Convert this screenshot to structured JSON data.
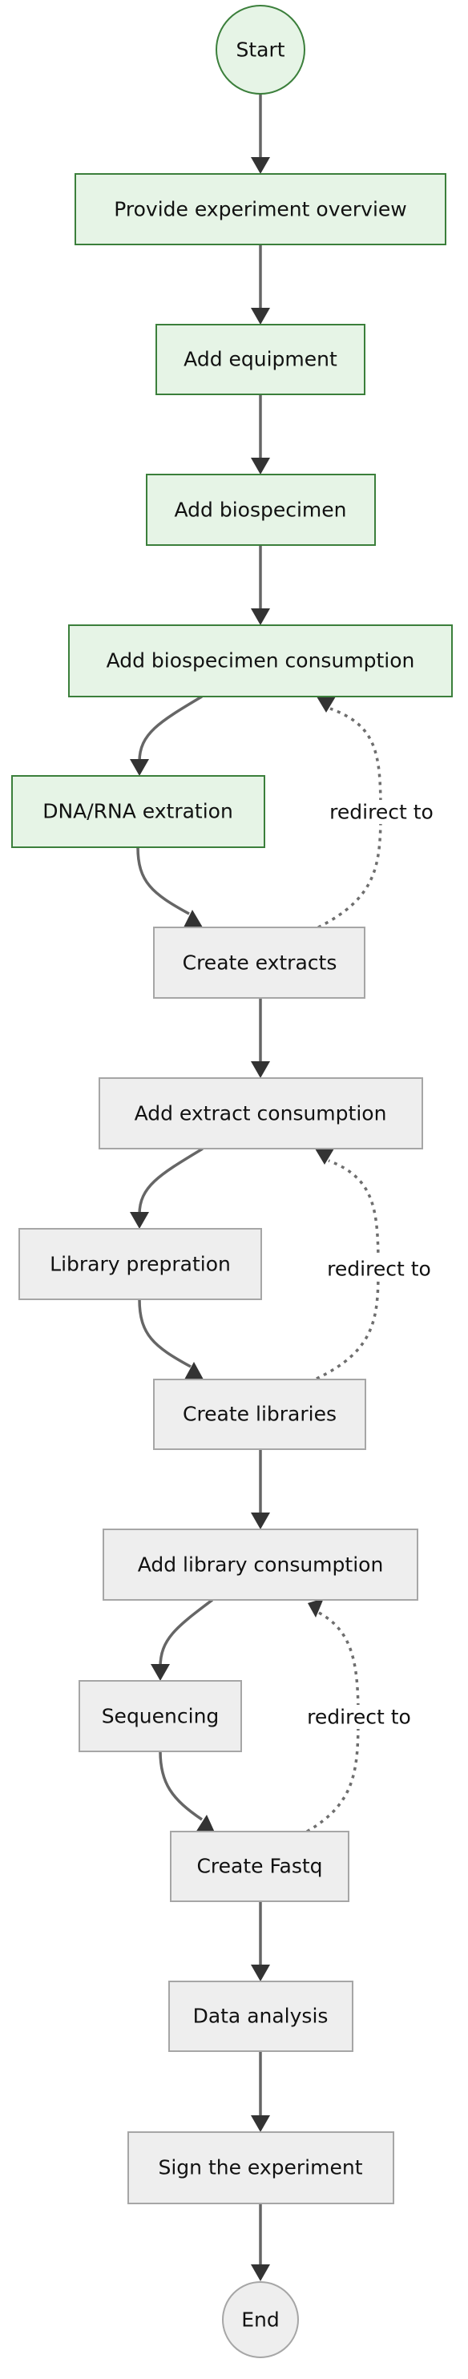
{
  "diagram": {
    "type": "flowchart",
    "direction": "top-to-bottom",
    "colors": {
      "completed_fill": "#e6f4e6",
      "completed_border": "#3b7f3b",
      "pending_fill": "#eeeeee",
      "pending_border": "#a6a6a6",
      "edge": "#666666",
      "arrowhead": "#333333"
    },
    "nodes": {
      "start": {
        "label": "Start",
        "shape": "circle",
        "status": "completed"
      },
      "overview": {
        "label": "Provide experiment overview",
        "shape": "rect",
        "status": "completed"
      },
      "equipment": {
        "label": "Add equipment",
        "shape": "rect",
        "status": "completed"
      },
      "biospecimen": {
        "label": "Add biospecimen",
        "shape": "rect",
        "status": "completed"
      },
      "biospecimen_consumption": {
        "label": "Add biospecimen consumption",
        "shape": "rect",
        "status": "completed"
      },
      "extraction": {
        "label": "DNA/RNA extration",
        "shape": "rect",
        "status": "completed"
      },
      "create_extracts": {
        "label": "Create extracts",
        "shape": "rect",
        "status": "pending"
      },
      "extract_consumption": {
        "label": "Add extract consumption",
        "shape": "rect",
        "status": "pending"
      },
      "library_prep": {
        "label": "Library prepration",
        "shape": "rect",
        "status": "pending"
      },
      "create_libraries": {
        "label": "Create libraries",
        "shape": "rect",
        "status": "pending"
      },
      "library_consumption": {
        "label": "Add library consumption",
        "shape": "rect",
        "status": "pending"
      },
      "sequencing": {
        "label": "Sequencing",
        "shape": "rect",
        "status": "pending"
      },
      "create_fastq": {
        "label": "Create Fastq",
        "shape": "rect",
        "status": "pending"
      },
      "data_analysis": {
        "label": "Data analysis",
        "shape": "rect",
        "status": "pending"
      },
      "sign": {
        "label": "Sign the experiment",
        "shape": "rect",
        "status": "pending"
      },
      "end": {
        "label": "End",
        "shape": "circle",
        "status": "pending"
      }
    },
    "edges": [
      {
        "from": "start",
        "to": "overview",
        "style": "solid"
      },
      {
        "from": "overview",
        "to": "equipment",
        "style": "solid"
      },
      {
        "from": "equipment",
        "to": "biospecimen",
        "style": "solid"
      },
      {
        "from": "biospecimen",
        "to": "biospecimen_consumption",
        "style": "solid"
      },
      {
        "from": "biospecimen_consumption",
        "to": "extraction",
        "style": "solid"
      },
      {
        "from": "extraction",
        "to": "create_extracts",
        "style": "solid"
      },
      {
        "from": "create_extracts",
        "to": "biospecimen_consumption",
        "style": "dotted",
        "label": "redirect to"
      },
      {
        "from": "create_extracts",
        "to": "extract_consumption",
        "style": "solid"
      },
      {
        "from": "extract_consumption",
        "to": "library_prep",
        "style": "solid"
      },
      {
        "from": "library_prep",
        "to": "create_libraries",
        "style": "solid"
      },
      {
        "from": "create_libraries",
        "to": "extract_consumption",
        "style": "dotted",
        "label": "redirect to"
      },
      {
        "from": "create_libraries",
        "to": "library_consumption",
        "style": "solid"
      },
      {
        "from": "library_consumption",
        "to": "sequencing",
        "style": "solid"
      },
      {
        "from": "sequencing",
        "to": "create_fastq",
        "style": "solid"
      },
      {
        "from": "create_fastq",
        "to": "library_consumption",
        "style": "dotted",
        "label": "redirect to"
      },
      {
        "from": "create_fastq",
        "to": "data_analysis",
        "style": "solid"
      },
      {
        "from": "data_analysis",
        "to": "sign",
        "style": "solid"
      },
      {
        "from": "sign",
        "to": "end",
        "style": "solid"
      }
    ],
    "edge_labels": {
      "redirect_1": "redirect to",
      "redirect_2": "redirect to",
      "redirect_3": "redirect to"
    }
  }
}
